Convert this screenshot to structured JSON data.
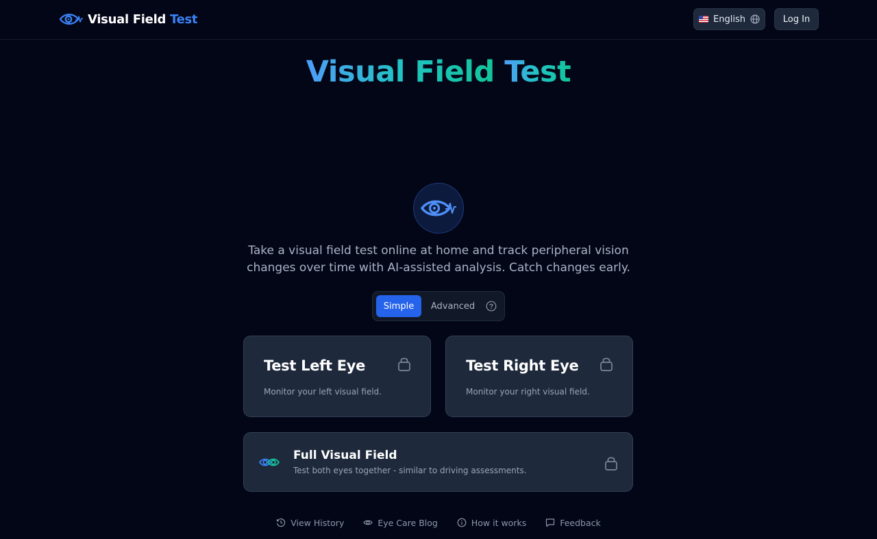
{
  "header": {
    "brand_word1": "Visual Field",
    "brand_word2": "Test",
    "language_label": "English",
    "login_label": "Log In"
  },
  "hero": {
    "title_word1": "Visual Field",
    "title_word2": "Test",
    "tagline_line1": "Take a visual field test online at home and track peripheral vision",
    "tagline_line2": "changes over time with AI-assisted analysis. Catch changes early."
  },
  "mode_toggle": {
    "simple_label": "Simple",
    "advanced_label": "Advanced",
    "selected": "Simple"
  },
  "cards": {
    "left": {
      "title": "Test Left Eye",
      "description": "Monitor your left visual field."
    },
    "right": {
      "title": "Test Right Eye",
      "description": "Monitor your right visual field."
    },
    "full": {
      "title": "Full Visual Field",
      "description": "Test both eyes together - similar to driving assessments."
    }
  },
  "footer": {
    "links": [
      {
        "label": "View History",
        "icon": "history-icon"
      },
      {
        "label": "Eye Care Blog",
        "icon": "eye-icon"
      },
      {
        "label": "How it works",
        "icon": "info-icon"
      },
      {
        "label": "Feedback",
        "icon": "chat-bubble-icon"
      }
    ]
  },
  "colors": {
    "background": "#030617",
    "accent_blue": "#3b82f6",
    "toggle_active": "#2563eb",
    "card_bg": "#1e293b",
    "gradient_start": "#4f9df8",
    "gradient_end": "#12c49a"
  }
}
